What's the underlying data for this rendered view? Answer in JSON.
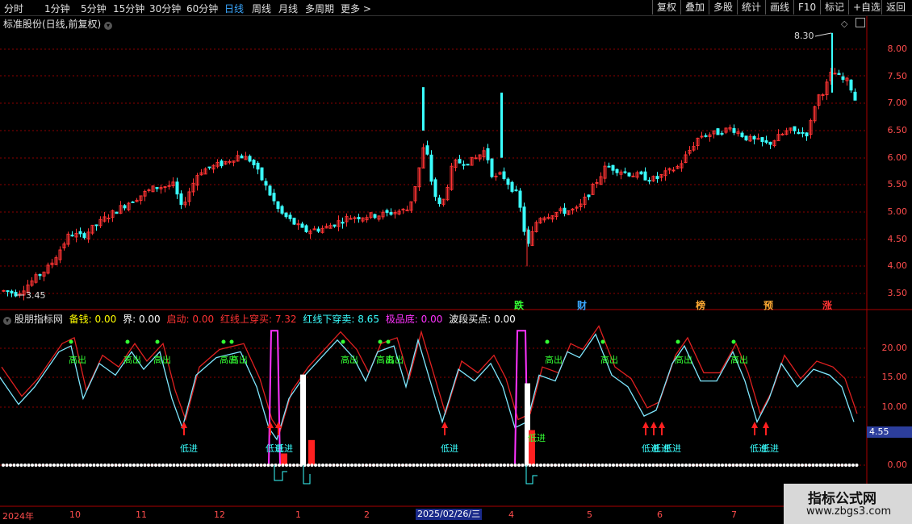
{
  "toolbar": {
    "timeframes": [
      "分时",
      "1分钟",
      "5分钟",
      "15分钟",
      "30分钟",
      "60分钟",
      "日线",
      "周线",
      "月线",
      "多周期",
      "更多 >"
    ],
    "active": "日线",
    "right_buttons": [
      "复权",
      "叠加",
      "多股",
      "统计",
      "画线",
      "F10",
      "标记",
      "+自选",
      "返回"
    ]
  },
  "main_panel": {
    "title": "标准股份(日线,前复权)",
    "high_label": "8.30",
    "low_label": "3.45",
    "y_ticks": [
      "8.00",
      "7.50",
      "7.00",
      "6.50",
      "6.00",
      "5.50",
      "5.00",
      "4.50",
      "4.00",
      "3.50"
    ],
    "events": [
      {
        "label": "跌",
        "color": "#33ff33"
      },
      {
        "label": "财",
        "color": "#3aa7ff"
      },
      {
        "label": "榜",
        "color": "#ffaa33"
      },
      {
        "label": "预",
        "color": "#ffaa33"
      },
      {
        "label": "涨",
        "color": "#ff3333"
      }
    ]
  },
  "indicator_panel": {
    "title": "股朋指标网",
    "params": [
      {
        "name": "备钱:",
        "value": "0.00",
        "color": "#ffff00"
      },
      {
        "name": "界:",
        "value": "0.00",
        "color": "#ffffff"
      },
      {
        "name": "启动:",
        "value": "0.00",
        "color": "#ff3333"
      },
      {
        "name": "红线上穿买:",
        "value": "7.32",
        "color": "#ff3333"
      },
      {
        "name": "红线下穿卖:",
        "value": "8.65",
        "color": "#3affff"
      },
      {
        "name": "极品底:",
        "value": "0.00",
        "color": "#ff33ff"
      },
      {
        "name": "波段买点:",
        "value": "0.00",
        "color": "#ffffff"
      }
    ],
    "y_ticks": [
      "20.00",
      "15.00",
      "10.00",
      "0.00"
    ],
    "current_value": "4.55",
    "high_label": "高出",
    "low_label": "低进"
  },
  "xaxis": {
    "labels": [
      "2024年",
      "10",
      "11",
      "12",
      "1",
      "2",
      "4",
      "5",
      "6",
      "7"
    ],
    "cursor_date": "2025/02/26/三"
  },
  "watermark": {
    "line1": "指标公式网",
    "line2": "www.zbgs3.com"
  },
  "colors": {
    "up": "#ff3333",
    "down": "#3affff",
    "grid": "#8b0000",
    "axis": "#ff4d4d"
  }
}
